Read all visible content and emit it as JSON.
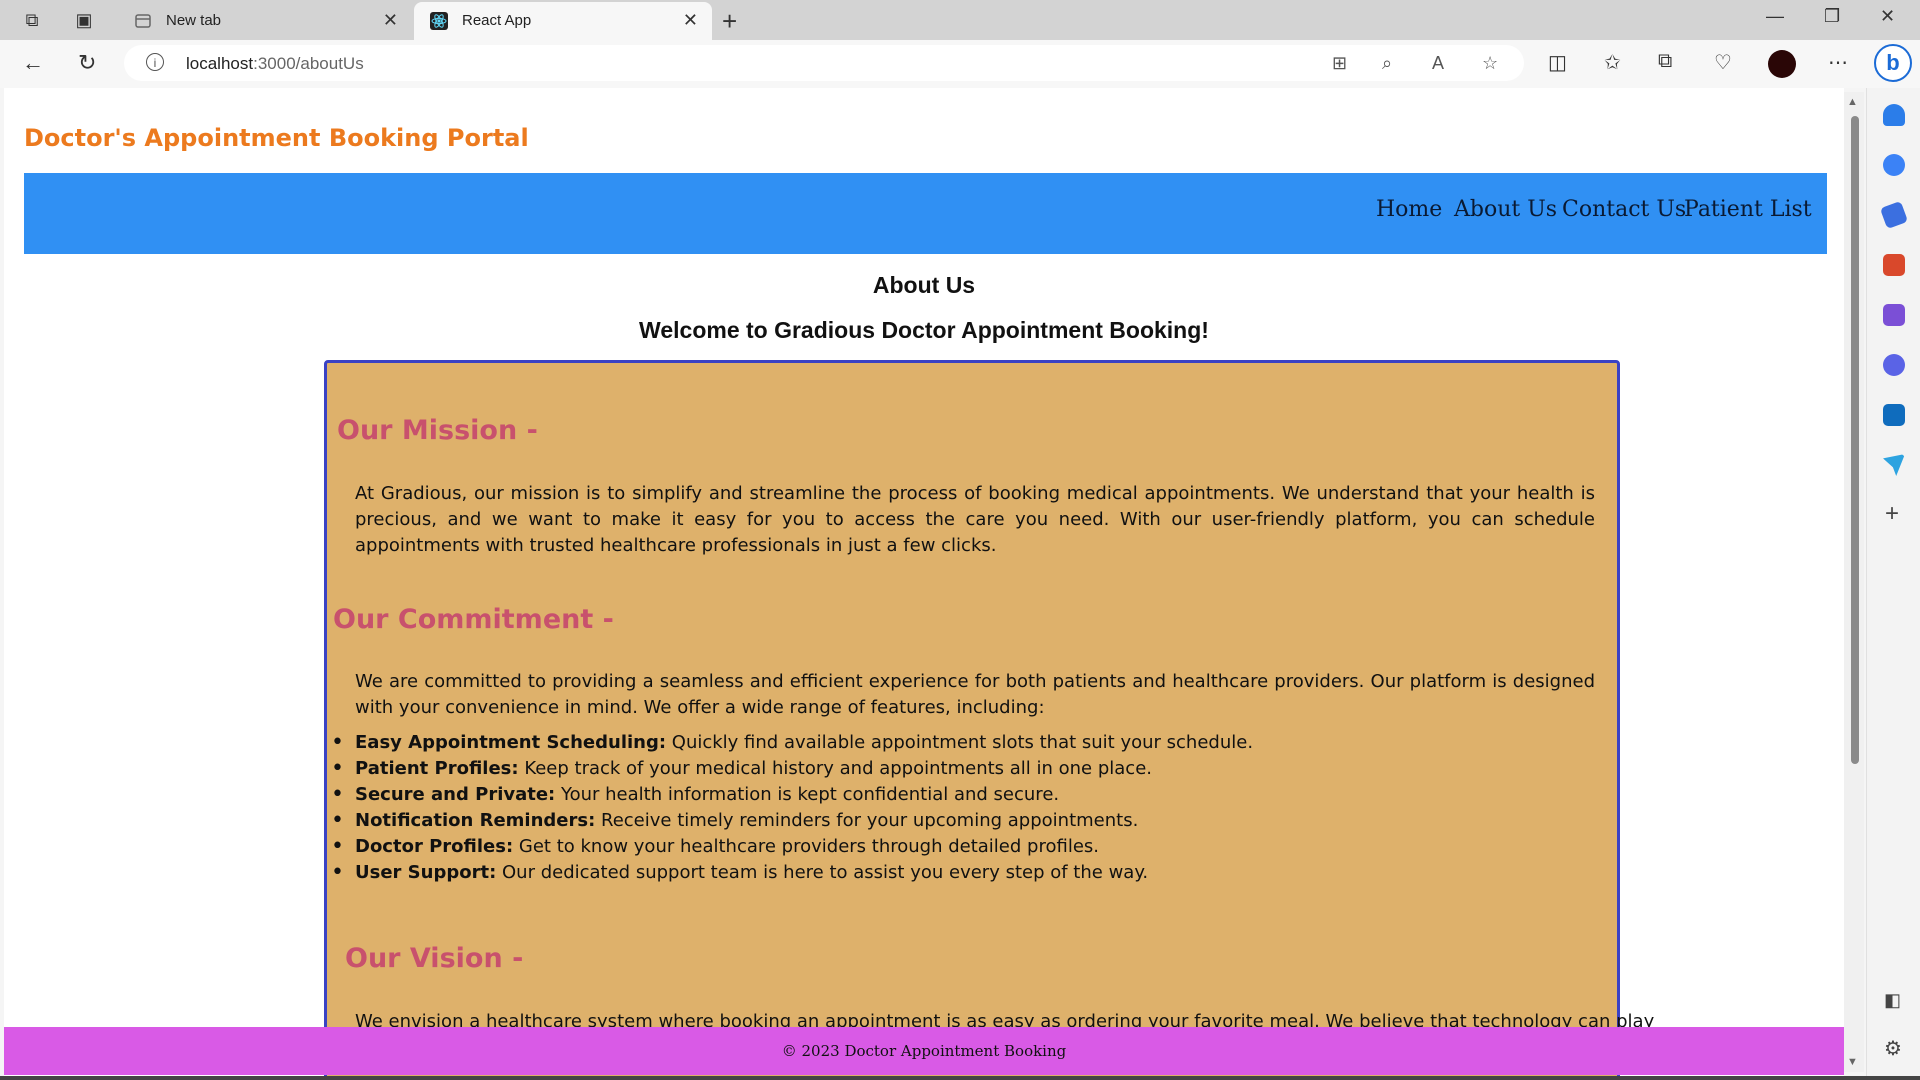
{
  "browser": {
    "tabs": [
      {
        "title": "New tab",
        "active": false
      },
      {
        "title": "React App",
        "active": true
      }
    ],
    "url_host": "localhost",
    "url_path": ":3000/aboutUs",
    "profile_color": "#2a0606"
  },
  "page": {
    "brand": "Doctor's Appointment Booking Portal",
    "nav": [
      "Home",
      "About Us",
      "Contact Us",
      "Patient List"
    ],
    "heading": "About Us",
    "welcome": "Welcome to Gradious Doctor Appointment Booking!",
    "mission": {
      "title": "Our Mission -",
      "text": "At Gradious, our mission is to simplify and streamline the process of booking medical appointments. We understand that your health is precious, and we want to make it easy for you to access the care you need. With our user-friendly platform, you can schedule appointments with trusted healthcare professionals in just a few clicks."
    },
    "commitment": {
      "title": "Our Commitment -",
      "text": "We are committed to providing a seamless and efficient experience for both patients and healthcare providers. Our platform is designed with your convenience in mind. We offer a wide range of features, including:",
      "features": [
        {
          "name": "Easy Appointment Scheduling:",
          "desc": " Quickly find available appointment slots that suit your schedule."
        },
        {
          "name": "Patient Profiles:",
          "desc": " Keep track of your medical history and appointments all in one place."
        },
        {
          "name": "Secure and Private:",
          "desc": " Your health information is kept confidential and secure."
        },
        {
          "name": "Notification Reminders:",
          "desc": " Receive timely reminders for your upcoming appointments."
        },
        {
          "name": "Doctor Profiles:",
          "desc": " Get to know your healthcare providers through detailed profiles."
        },
        {
          "name": "User Support:",
          "desc": " Our dedicated support team is here to assist you every step of the way."
        }
      ]
    },
    "vision": {
      "title": "Our Vision -",
      "text": "We envision a healthcare system where booking an appointment is as easy as ordering your favorite meal. We believe that technology can play"
    },
    "footer": "© 2023 Doctor Appointment Booking"
  },
  "colors": {
    "brand": "#ec7a1e",
    "navbar": "#3090f3",
    "card_bg": "#deb16b",
    "card_border": "#3a42c4",
    "section_title": "#c8516d",
    "footer": "#d95ae6"
  }
}
